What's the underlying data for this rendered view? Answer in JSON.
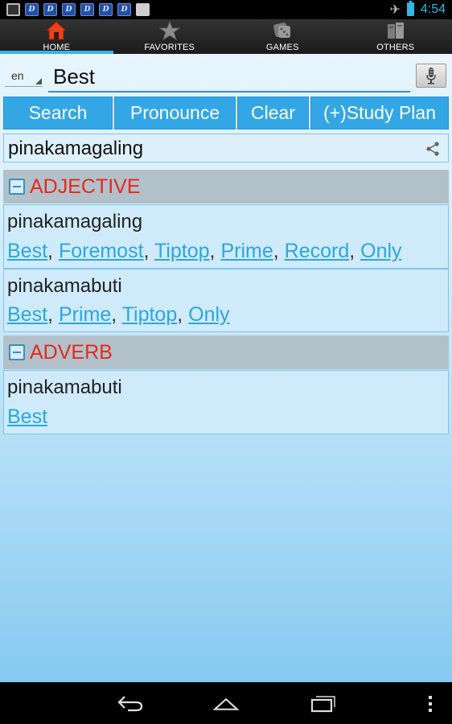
{
  "status_bar": {
    "time": "4:54",
    "left_icons": [
      "picture-icon",
      "dictionary-app-icon",
      "dictionary-app-icon",
      "dictionary-app-icon",
      "dictionary-app-icon",
      "dictionary-app-icon",
      "dictionary-app-icon",
      "shopping-bag-icon"
    ],
    "dict_letter": "D"
  },
  "tabs": [
    {
      "label": "HOME",
      "icon": "home-icon",
      "active": true
    },
    {
      "label": "FAVORITES",
      "icon": "star-icon",
      "active": false
    },
    {
      "label": "GAMES",
      "icon": "games-icon",
      "active": false
    },
    {
      "label": "OTHERS",
      "icon": "others-icon",
      "active": false
    }
  ],
  "search": {
    "language": "en",
    "value": "Best"
  },
  "buttons": {
    "search": "Search",
    "pronounce": "Pronounce",
    "clear": "Clear",
    "study_plan": "(+)Study Plan"
  },
  "result": {
    "word": "pinakamagaling"
  },
  "sections": [
    {
      "title": "ADJECTIVE",
      "entries": [
        {
          "word": "pinakamagaling",
          "synonyms": [
            "Best",
            "Foremost",
            "Tiptop",
            "Prime",
            "Record",
            "Only"
          ]
        },
        {
          "word": "pinakamabuti",
          "synonyms": [
            "Best",
            "Prime",
            "Tiptop",
            "Only"
          ]
        }
      ]
    },
    {
      "title": "ADVERB",
      "entries": [
        {
          "word": "pinakamabuti",
          "synonyms": [
            "Best"
          ]
        }
      ]
    }
  ],
  "separator": ", ",
  "colors": {
    "accent": "#33b5e5",
    "button_blue": "#33a7e6",
    "pos_red": "#e8271d",
    "link_blue": "#2aa8e0"
  }
}
